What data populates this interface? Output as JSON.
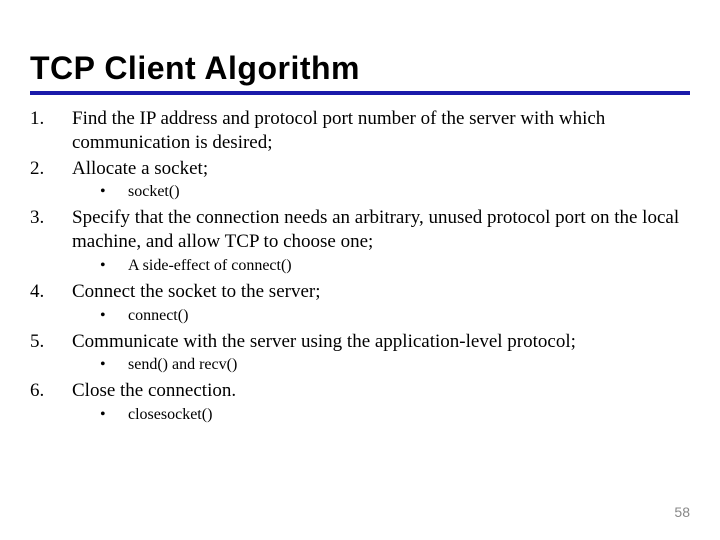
{
  "title": "TCP Client Algorithm",
  "items": [
    {
      "num": "1.",
      "text": "Find the IP address and protocol port number of the server with which communication is desired;",
      "sub": []
    },
    {
      "num": "2.",
      "text": "Allocate a socket;",
      "sub": [
        {
          "bullet": "•",
          "text": "socket()"
        }
      ]
    },
    {
      "num": "3.",
      "text": "Specify that the connection needs an arbitrary, unused protocol port on the local machine, and allow TCP to choose one;",
      "sub": [
        {
          "bullet": "•",
          "text": "A side-effect of connect()"
        }
      ]
    },
    {
      "num": "4.",
      "text": "Connect the socket to the server;",
      "sub": [
        {
          "bullet": "•",
          "text": "connect()"
        }
      ]
    },
    {
      "num": "5.",
      "text": "Communicate with the server using the application-level protocol;",
      "sub": [
        {
          "bullet": "•",
          "text": "send() and recv()"
        }
      ]
    },
    {
      "num": "6.",
      "text": "Close the connection.",
      "sub": [
        {
          "bullet": "•",
          "text": "closesocket()"
        }
      ]
    }
  ],
  "page_number": "58"
}
